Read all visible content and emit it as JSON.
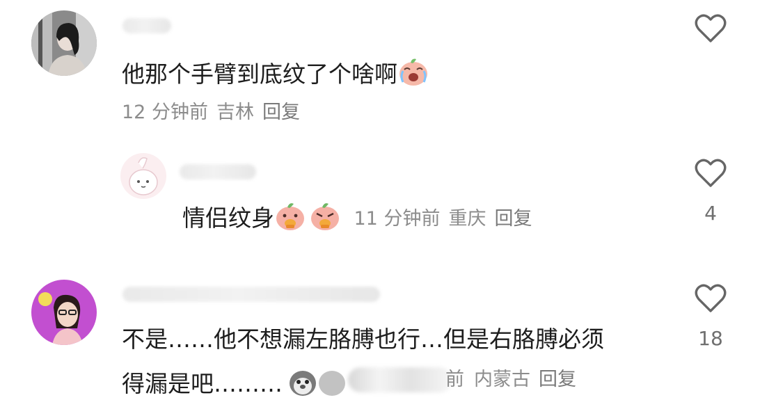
{
  "comments": [
    {
      "text": "他那个手臂到底纹了个啥啊",
      "emoji": "crying-face-emoji",
      "meta": {
        "time": "12 分钟前",
        "location": "吉林",
        "reply": "回复"
      },
      "likes": ""
    },
    {
      "text": "情侣纹身",
      "emoji": "peach-eating-emoji",
      "meta": {
        "time": "11 分钟前",
        "location": "重庆",
        "reply": "回复"
      },
      "likes": "4"
    },
    {
      "text_line1": "不是……他不想漏左胳膊也行…但是右胳膊必须",
      "text_line2": "得漏是吧………",
      "emoji": "penguin-emoji",
      "meta": {
        "time_fragment": "前",
        "location": "内蒙古",
        "reply": "回复"
      },
      "likes": "18"
    }
  ],
  "colors": {
    "meta": "#8c8c8c",
    "text": "#1d1d1d",
    "heart": "#666666"
  },
  "icons": [
    "heart-outline-icon"
  ]
}
